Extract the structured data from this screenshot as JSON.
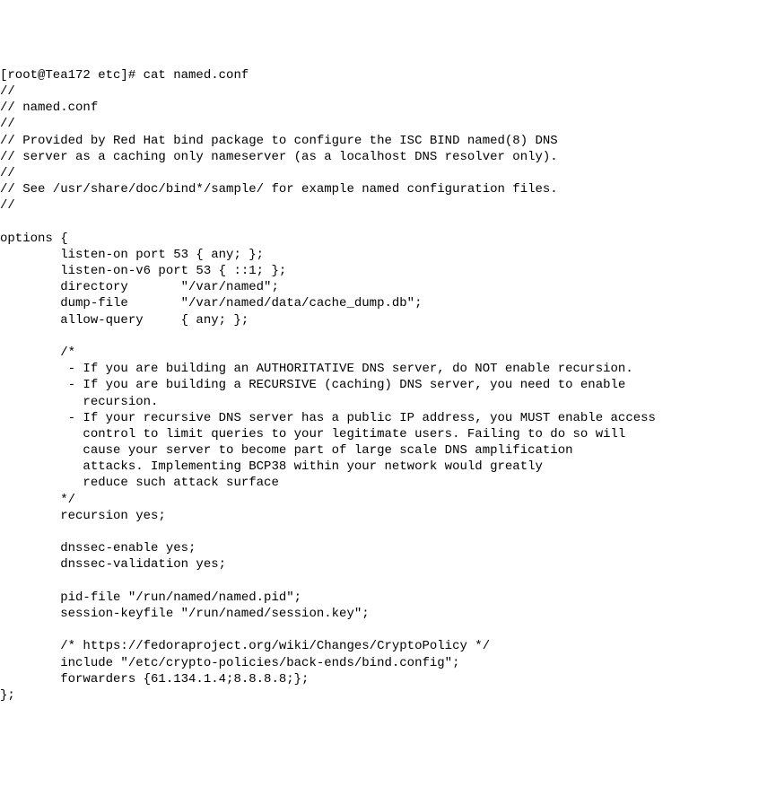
{
  "terminal": {
    "prompt": "[root@Tea172 etc]# cat named.conf",
    "lines": [
      "//",
      "// named.conf",
      "//",
      "// Provided by Red Hat bind package to configure the ISC BIND named(8) DNS",
      "// server as a caching only nameserver (as a localhost DNS resolver only).",
      "//",
      "// See /usr/share/doc/bind*/sample/ for example named configuration files.",
      "//",
      "",
      "options {",
      "        listen-on port 53 { any; };",
      "        listen-on-v6 port 53 { ::1; };",
      "        directory       \"/var/named\";",
      "        dump-file       \"/var/named/data/cache_dump.db\";",
      "        allow-query     { any; };",
      "",
      "        /*",
      "         - If you are building an AUTHORITATIVE DNS server, do NOT enable recursion.",
      "         - If you are building a RECURSIVE (caching) DNS server, you need to enable",
      "           recursion.",
      "         - If your recursive DNS server has a public IP address, you MUST enable access",
      "           control to limit queries to your legitimate users. Failing to do so will",
      "           cause your server to become part of large scale DNS amplification",
      "           attacks. Implementing BCP38 within your network would greatly",
      "           reduce such attack surface",
      "        */",
      "        recursion yes;",
      "",
      "        dnssec-enable yes;",
      "        dnssec-validation yes;",
      "",
      "        pid-file \"/run/named/named.pid\";",
      "        session-keyfile \"/run/named/session.key\";",
      "",
      "        /* https://fedoraproject.org/wiki/Changes/CryptoPolicy */",
      "        include \"/etc/crypto-policies/back-ends/bind.config\";",
      "        forwarders {61.134.1.4;8.8.8.8;};",
      "};"
    ]
  }
}
